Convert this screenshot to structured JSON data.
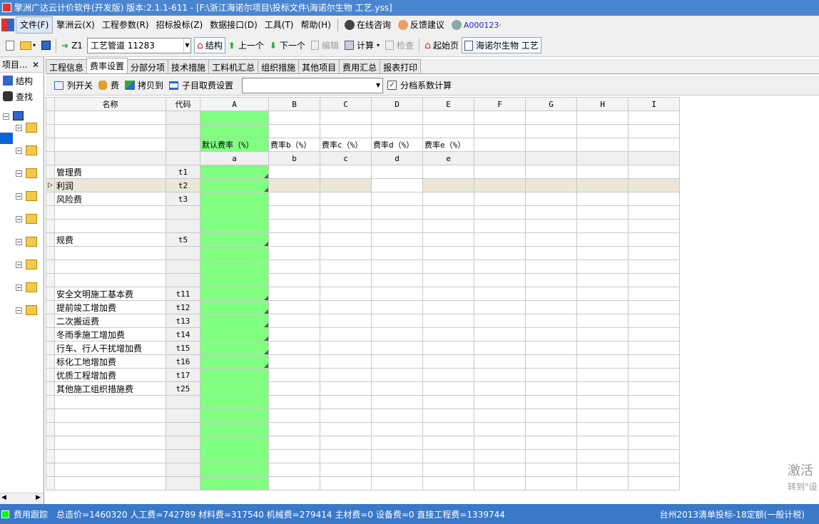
{
  "window": {
    "title": "擎洲广达云计价软件(开发版) 版本:2.1.1-611 - [F:\\浙江海诺尔项目\\投标文件\\海诺尔生物 工艺.yss]"
  },
  "menu": {
    "items": [
      "文件(F)",
      "擎洲云(X)",
      "工程参数(R)",
      "招标投标(Z)",
      "数据接口(D)",
      "工具(T)",
      "帮助(H)"
    ],
    "online": "在线咨询",
    "feedback": "反馈建议",
    "user": "A000123·"
  },
  "toolbar": {
    "z1": "Z1",
    "combo_value": "工艺管道 11283",
    "structure": "结构",
    "prev": "上一个",
    "next": "下一个",
    "edit": "编辑",
    "calc": "计算",
    "check": "检查",
    "home": "起始页",
    "doc": "海诺尔生物 工艺"
  },
  "left_pane": {
    "header": "项目...",
    "close": "✕",
    "structure": "结构",
    "find": "查找"
  },
  "tabs": [
    "工程信息",
    "费率设置",
    "分部分项",
    "技术措施",
    "工料机汇总",
    "组织措施",
    "其他项目",
    "费用汇总",
    "报表打印"
  ],
  "active_tab": "费率设置",
  "subtoolbar": {
    "toggle_cols": "列开关",
    "fee": "费",
    "copy_to": "拷贝到",
    "sub_fee": "子目取费设置",
    "tiered_label": "分档系数计算",
    "tiered_checked": "✓"
  },
  "grid": {
    "headers": [
      "名称",
      "代码",
      "A",
      "B",
      "C",
      "D",
      "E",
      "F",
      "G",
      "H",
      "I"
    ],
    "rate_headers": [
      "默认费率（%）",
      "费率b（%）",
      "费率c（%）",
      "费率d（%）",
      "费率e（%）"
    ],
    "rate_codes": [
      "a",
      "b",
      "c",
      "d",
      "e"
    ],
    "rows": [
      {
        "name": "管理费",
        "code": "t1"
      },
      {
        "name": "利润",
        "code": "t2"
      },
      {
        "name": "风险费",
        "code": "t3"
      },
      {
        "name": "",
        "code": ""
      },
      {
        "name": "",
        "code": ""
      },
      {
        "name": "规费",
        "code": "t5"
      },
      {
        "name": "",
        "code": ""
      },
      {
        "name": "",
        "code": ""
      },
      {
        "name": "",
        "code": ""
      },
      {
        "name": "安全文明施工基本费",
        "code": "t11"
      },
      {
        "name": "提前竣工增加费",
        "code": "t12"
      },
      {
        "name": "二次搬运费",
        "code": "t13"
      },
      {
        "name": "冬雨季施工增加费",
        "code": "t14"
      },
      {
        "name": "行车、行人干扰增加费",
        "code": "t15"
      },
      {
        "name": "标化工地增加费",
        "code": "t16"
      },
      {
        "name": "优质工程增加费",
        "code": "t17"
      },
      {
        "name": "其他施工组织措施费",
        "code": "t25"
      }
    ],
    "row_marker": "▷"
  },
  "status": {
    "label": "费用跟踪",
    "summary": "总造价=1460320 人工费=742789 材料费=317540 机械费=279414 主材费=0 设备费=0 直接工程费=1339744",
    "right": "台州2013清单投标-18定额(一般计税)"
  },
  "watermark": {
    "line1": "激活",
    "line2": "转到\"设"
  }
}
